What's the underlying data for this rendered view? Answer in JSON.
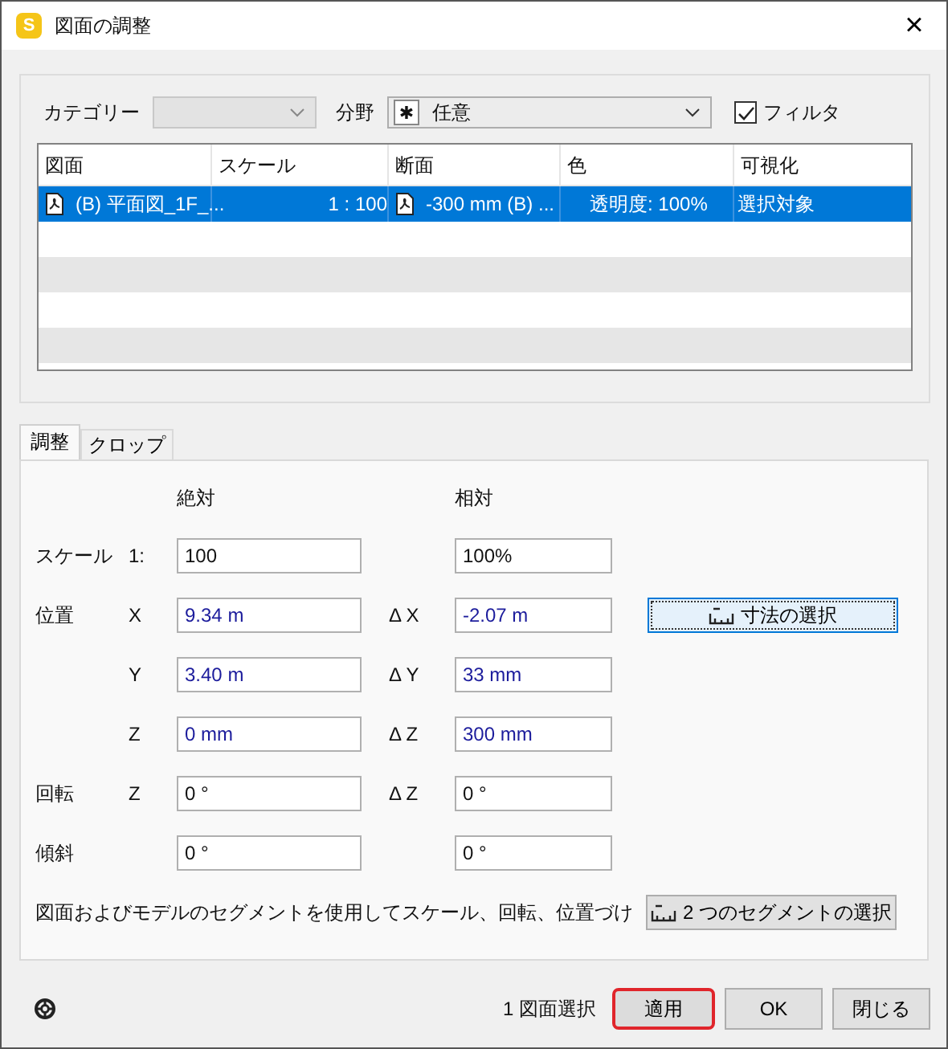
{
  "window": {
    "app_icon_letter": "S",
    "title": "図面の調整",
    "close": "×"
  },
  "filters": {
    "category_label": "カテゴリー",
    "category_disabled": true,
    "field_label": "分野",
    "field_symbol": "✱",
    "field_value": "任意",
    "filter_label": "フィルタ",
    "filter_checked": true
  },
  "table": {
    "columns": [
      "図面",
      "スケール",
      "断面",
      "色",
      "可視化"
    ],
    "rows": [
      {
        "selected": true,
        "cells": [
          {
            "text": "(B) 平面図_1F_...",
            "icon": true
          },
          {
            "text": "1 : 100",
            "icon": false
          },
          {
            "text": "-300 mm (B) ...",
            "icon": true
          },
          {
            "text": "透明度: 100%",
            "icon": false
          },
          {
            "text": "選択対象",
            "icon": false
          }
        ]
      }
    ]
  },
  "tabs": [
    {
      "label": "調整",
      "selected": true
    },
    {
      "label": "クロップ",
      "selected": false
    }
  ],
  "adjust": {
    "absolute_header": "絶対",
    "relative_header": "相対",
    "rows": [
      {
        "label": "スケール",
        "axis": "1:",
        "absolute": "100",
        "delta_label": "",
        "relative": "100%",
        "changed": false
      },
      {
        "label": "位置",
        "axis": "X",
        "absolute": "9.34 m",
        "delta_label": "Δ X",
        "relative": "-2.07 m",
        "changed": true,
        "button": "寸法の選択"
      },
      {
        "label": "",
        "axis": "Y",
        "absolute": "3.40 m",
        "delta_label": "Δ Y",
        "relative": "33 mm",
        "changed": true
      },
      {
        "label": "",
        "axis": "Z",
        "absolute": "0 mm",
        "delta_label": "Δ Z",
        "relative": "300 mm",
        "changed": true
      },
      {
        "label": "回転",
        "axis": "Z",
        "absolute": "0 °",
        "delta_label": "Δ Z",
        "relative": "0 °",
        "changed": false
      },
      {
        "label": "傾斜",
        "axis": "",
        "absolute": "0 °",
        "delta_label": "",
        "relative": "0 °",
        "changed": false
      }
    ],
    "description": "図面およびモデルのセグメントを使用してスケール、回転、位置づけ",
    "segment_button": "2 つのセグメントの選択"
  },
  "footer": {
    "status": "1 図面選択",
    "buttons": [
      {
        "label": "適用",
        "highlighted": true
      },
      {
        "label": "OK",
        "highlighted": false
      },
      {
        "label": "閉じる",
        "highlighted": false
      }
    ]
  }
}
